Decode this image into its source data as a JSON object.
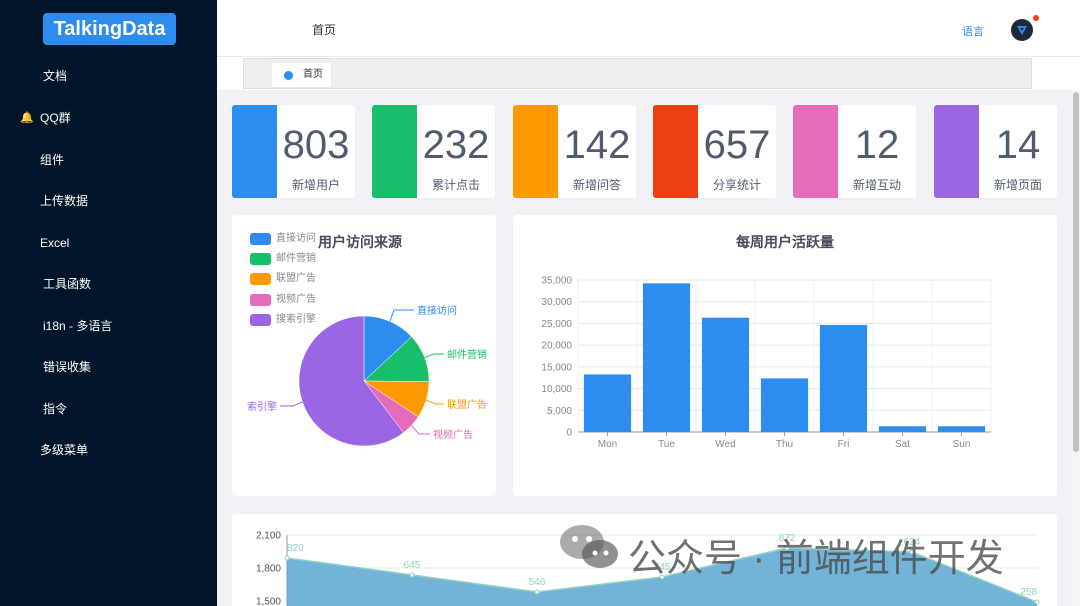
{
  "sidebar": {
    "logo": "TalkingData",
    "items": [
      {
        "label": "文档"
      },
      {
        "label": "QQ群"
      },
      {
        "label": "组件"
      },
      {
        "label": "上传数据"
      },
      {
        "label": "Excel"
      },
      {
        "label": "工具函数"
      },
      {
        "label": "i18n - 多语言"
      },
      {
        "label": "错误收集"
      },
      {
        "label": "指令"
      },
      {
        "label": "多级菜单"
      }
    ]
  },
  "header": {
    "title": "首页",
    "language": "语言"
  },
  "tags": [
    {
      "label": "首页"
    }
  ],
  "cards": [
    {
      "value": "803",
      "label": "新增用户",
      "color": "#2d8cf0"
    },
    {
      "value": "232",
      "label": "累计点击",
      "color": "#19be6b"
    },
    {
      "value": "142",
      "label": "新增问答",
      "color": "#ff9900"
    },
    {
      "value": "657",
      "label": "分享统计",
      "color": "#ed3f14"
    },
    {
      "value": "12",
      "label": "新增互动",
      "color": "#E46CBB"
    },
    {
      "value": "14",
      "label": "新增页面",
      "color": "#9A66E4"
    }
  ],
  "pie": {
    "title": "用户访问来源",
    "legend": [
      "直接访问",
      "邮件营销",
      "联盟广告",
      "视频广告",
      "搜索引擎"
    ],
    "callouts": [
      "直接访问",
      "邮件营销",
      "联盟广告",
      "视频广告",
      "索引擎"
    ]
  },
  "bar": {
    "title": "每周用户活跃量"
  },
  "watermark": {
    "text": "公众号 · 前端组件开发"
  },
  "chart_data": [
    {
      "type": "pie",
      "title": "用户访问来源",
      "categories": [
        "直接访问",
        "邮件营销",
        "联盟广告",
        "视频广告",
        "搜索引擎"
      ],
      "values": [
        335,
        310,
        234,
        135,
        1548
      ],
      "colors": [
        "#2d8cf0",
        "#19be6b",
        "#ff9900",
        "#E46CBB",
        "#9A66E4"
      ],
      "legend": "top-left"
    },
    {
      "type": "bar",
      "title": "每周用户活跃量",
      "categories": [
        "Mon",
        "Tue",
        "Wed",
        "Thu",
        "Fri",
        "Sat",
        "Sun"
      ],
      "values": [
        13253,
        34235,
        26321,
        12340,
        24643,
        1322,
        1324
      ],
      "yticks": [
        "0",
        "5,000",
        "10,000",
        "15,000",
        "20,000",
        "25,000",
        "30,000",
        "35,000"
      ],
      "ylim": [
        0,
        35000
      ],
      "color": "#2d8cf0",
      "grid": true
    },
    {
      "type": "area",
      "values": [
        820,
        645,
        546,
        745,
        872,
        624,
        258
      ],
      "yticks": [
        "1,500",
        "1,800",
        "2,100"
      ],
      "ylim": [
        1200,
        2100
      ],
      "color": "#5aa6d0"
    }
  ]
}
